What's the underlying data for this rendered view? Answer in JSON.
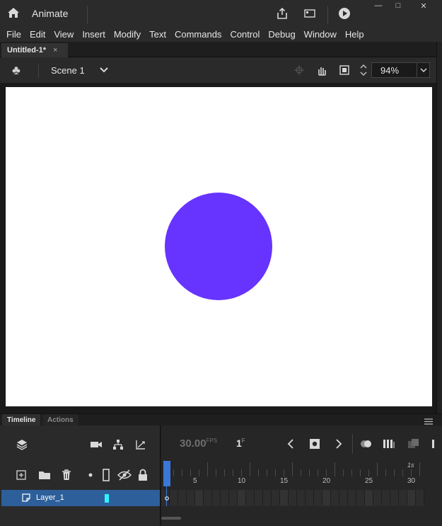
{
  "app": {
    "name": "Animate"
  },
  "window_controls": {
    "minimize": "—",
    "maximize": "□",
    "close": "✕"
  },
  "menu": [
    "File",
    "Edit",
    "View",
    "Insert",
    "Modify",
    "Text",
    "Commands",
    "Control",
    "Debug",
    "Window",
    "Help"
  ],
  "document_tab": {
    "title": "Untitled-1*",
    "close": "×"
  },
  "scene_bar": {
    "scene_name": "Scene 1",
    "zoom_value": "94%"
  },
  "stage": {
    "background_color": "#ffffff",
    "shape_color": "#6633ff"
  },
  "timeline": {
    "tabs": [
      "Timeline",
      "Actions"
    ],
    "fps_value": "30.00",
    "fps_unit": "FPS",
    "current_frame": "1",
    "frame_unit": "F",
    "ruler_labels": [
      "5",
      "10",
      "15",
      "20",
      "25",
      "30"
    ],
    "ruler_seconds_label": "1s",
    "layers": [
      {
        "name": "Layer_1",
        "color": "#2ff3ff"
      }
    ]
  }
}
